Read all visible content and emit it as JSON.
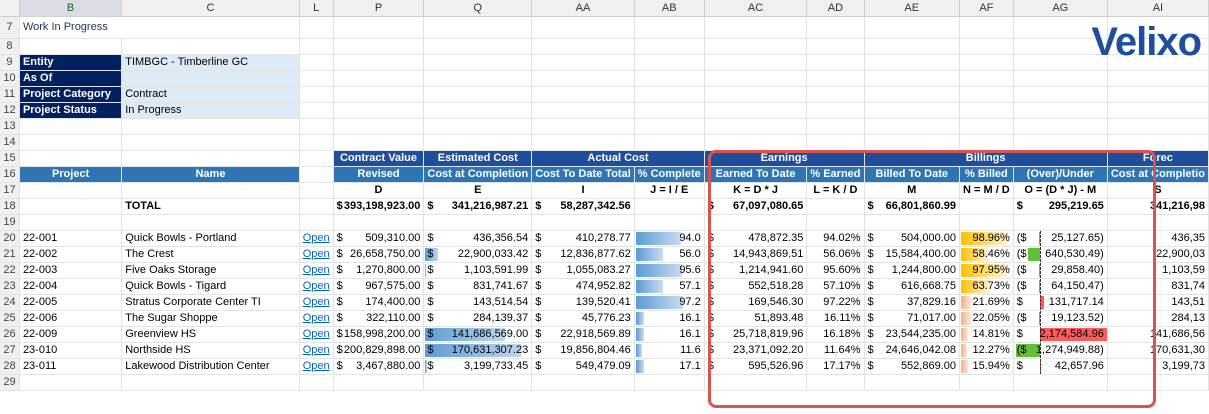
{
  "logo_text": "Velixo",
  "sheet_title": "Work In Progress",
  "columns": [
    "B",
    "C",
    "L",
    "P",
    "Q",
    "AA",
    "AB",
    "AC",
    "AD",
    "AE",
    "AF",
    "AG",
    "AI"
  ],
  "row_numbers": [
    "7",
    "8",
    "9",
    "10",
    "11",
    "12",
    "13",
    "14",
    "15",
    "16",
    "17",
    "18",
    "19",
    "20",
    "21",
    "22",
    "23",
    "24",
    "25",
    "26",
    "27",
    "28",
    "29"
  ],
  "params": [
    {
      "label": "Entity",
      "value": "TIMBGC - Timberline GC"
    },
    {
      "label": "As Of",
      "value": ""
    },
    {
      "label": "Project Category",
      "value": "Contract"
    },
    {
      "label": "Project Status",
      "value": "In Progress"
    }
  ],
  "groups": {
    "contract_value": "Contract Value",
    "estimated_cost": "Estimated Cost",
    "actual_cost": "Actual Cost",
    "earnings": "Earnings",
    "billings": "Billings",
    "forecast": "Forec"
  },
  "headers": {
    "project": "Project",
    "name": "Name",
    "revised": "Revised",
    "cost_at_completion": "Cost at Completion",
    "cost_to_date": "Cost To Date Total",
    "pct_complete": "% Complete",
    "earned_to_date": "Earned To Date",
    "pct_earned": "% Earned",
    "billed_to_date": "Billed To Date",
    "pct_billed": "% Billed",
    "over_under": "(Over)/Under",
    "cost_at_comp2": "Cost at Completio"
  },
  "formulas": {
    "d": "D",
    "e": "E",
    "i": "I",
    "j": "J = I / E",
    "k": "K = D * J",
    "l": "L = K / D",
    "m": "M",
    "n": "N = M / D",
    "o": "O = (D * J) - M",
    "s": "S"
  },
  "total": {
    "label": "TOTAL",
    "dollar": "$",
    "revised": "393,198,923.00",
    "cost": "341,216,987.21",
    "ctd": "58,287,342.56",
    "earned": "67,097,080.65",
    "billed": "66,801,860.99",
    "over": "295,219.65",
    "s": "341,216,98"
  },
  "open_label": "Open",
  "rows": [
    {
      "project": "22-001",
      "name": "Quick Bowls - Portland",
      "revised": "509,310.00",
      "cost": "436,356.54",
      "ctd": "410,278.77",
      "pct": "94.0",
      "pct_frac": 0.94,
      "earned": "478,872.35",
      "pe": "94.02%",
      "billed": "504,000.00",
      "pb": "98.96%",
      "pb_frac": 0.99,
      "pb_color": "yellow",
      "ou_dollar": "($",
      "ou": "25,127.65)",
      "ou_val": -25127.65,
      "s": "436,35"
    },
    {
      "project": "22-002",
      "name": "The Crest",
      "revised": "26,658,750.00",
      "cost": "22,900,033.42",
      "ctd": "12,836,877.62",
      "pct": "56.0",
      "pct_frac": 0.56,
      "earned": "14,943,869.51",
      "pe": "56.06%",
      "billed": "15,584,400.00",
      "pb": "58.46%",
      "pb_frac": 0.58,
      "pb_color": "yellow",
      "ou_dollar": "($",
      "ou": "640,530.49)",
      "ou_val": -640530.49,
      "s": "22,900,03"
    },
    {
      "project": "22-003",
      "name": "Five Oaks Storage",
      "revised": "1,270,800.00",
      "cost": "1,103,591.99",
      "ctd": "1,055,083.27",
      "pct": "95.6",
      "pct_frac": 0.956,
      "earned": "1,214,941.60",
      "pe": "95.60%",
      "billed": "1,244,800.00",
      "pb": "97.95%",
      "pb_frac": 0.98,
      "pb_color": "yellow",
      "ou_dollar": "($",
      "ou": "29,858.40)",
      "ou_val": -29858.4,
      "s": "1,103,59"
    },
    {
      "project": "22-004",
      "name": "Quick Bowls - Tigard",
      "revised": "967,575.00",
      "cost": "831,741.67",
      "ctd": "474,952.82",
      "pct": "57.1",
      "pct_frac": 0.571,
      "earned": "552,518.28",
      "pe": "57.10%",
      "billed": "616,668.75",
      "pb": "63.73%",
      "pb_frac": 0.64,
      "pb_color": "yellow",
      "ou_dollar": "($",
      "ou": "64,150.47)",
      "ou_val": -64150.47,
      "s": "831,74"
    },
    {
      "project": "22-005",
      "name": "Stratus Corporate Center TI",
      "revised": "174,400.00",
      "cost": "143,514.54",
      "ctd": "139,520.41",
      "pct": "97.2",
      "pct_frac": 0.972,
      "earned": "169,546.30",
      "pe": "97.22%",
      "billed": "37,829.16",
      "pb": "21.69%",
      "pb_frac": 0.22,
      "pb_color": "orange",
      "ou_dollar": "$",
      "ou": "131,717.14",
      "ou_val": 131717.14,
      "s": "143,51"
    },
    {
      "project": "22-006",
      "name": "The Sugar Shoppe",
      "revised": "322,110.00",
      "cost": "284,139.37",
      "ctd": "45,776.23",
      "pct": "16.1",
      "pct_frac": 0.161,
      "earned": "51,893.48",
      "pe": "16.11%",
      "billed": "71,017.00",
      "pb": "22.05%",
      "pb_frac": 0.22,
      "pb_color": "orange",
      "ou_dollar": "($",
      "ou": "19,123.52)",
      "ou_val": -19123.52,
      "s": "284,13"
    },
    {
      "project": "22-009",
      "name": "Greenview HS",
      "revised": "158,998,200.00",
      "cost": "141,686,569.00",
      "ctd": "22,918,569.89",
      "pct": "16.1",
      "pct_frac": 0.161,
      "earned": "25,718,819.96",
      "pe": "16.18%",
      "billed": "23,544,235.00",
      "pb": "14.81%",
      "pb_frac": 0.15,
      "pb_color": "orange",
      "ou_dollar": "$",
      "ou": "2,174,584.96",
      "ou_val": 2174584.96,
      "s": "141,686,56"
    },
    {
      "project": "23-010",
      "name": "Northside HS",
      "revised": "200,829,898.00",
      "cost": "170,631,307.23",
      "ctd": "19,856,804.46",
      "pct": "11.6",
      "pct_frac": 0.116,
      "earned": "23,371,092.20",
      "pe": "11.64%",
      "billed": "24,646,042.08",
      "pb": "12.27%",
      "pb_frac": 0.12,
      "pb_color": "orange",
      "ou_dollar": "($",
      "ou": "1,274,949.88)",
      "ou_val": -1274949.88,
      "s": "170,631,30"
    },
    {
      "project": "23-011",
      "name": "Lakewood Distribution Center",
      "revised": "3,467,880.00",
      "cost": "3,199,733.45",
      "ctd": "549,479.09",
      "pct": "17.1",
      "pct_frac": 0.171,
      "earned": "595,526.96",
      "pe": "17.17%",
      "billed": "552,869.00",
      "pb": "15.94%",
      "pb_frac": 0.16,
      "pb_color": "orange",
      "ou_dollar": "$",
      "ou": "42,657.96",
      "ou_val": 42657.96,
      "s": "3,199,73"
    }
  ]
}
